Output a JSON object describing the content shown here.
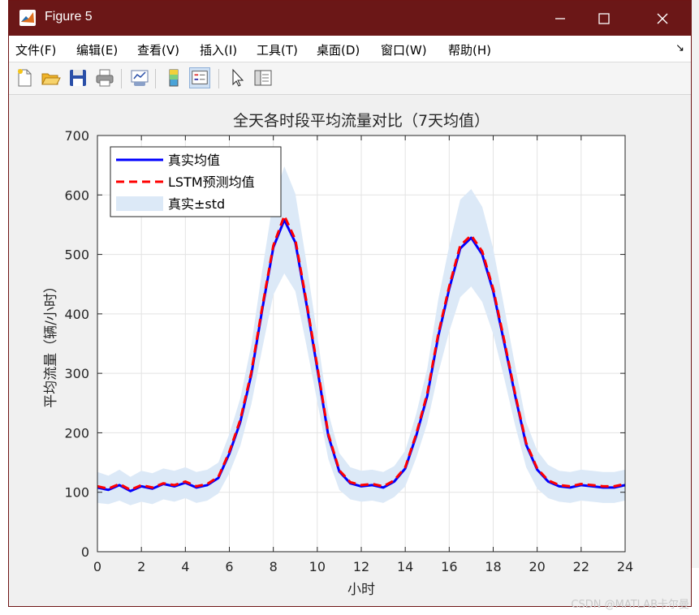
{
  "window": {
    "title": "Figure 5",
    "buttons": [
      "minimize",
      "maximize",
      "close"
    ]
  },
  "menu": {
    "items": [
      {
        "label": "文件",
        "key": "(F)"
      },
      {
        "label": "编辑",
        "key": "(E)"
      },
      {
        "label": "查看",
        "key": "(V)"
      },
      {
        "label": "插入",
        "key": "(I)"
      },
      {
        "label": "工具",
        "key": "(T)"
      },
      {
        "label": "桌面",
        "key": "(D)"
      },
      {
        "label": "窗口",
        "key": "(W)"
      },
      {
        "label": "帮助",
        "key": "(H)"
      }
    ]
  },
  "toolbar": {
    "icons": [
      "new-figure-icon",
      "open-file-icon",
      "save-icon",
      "print-icon",
      "link-plot-icon",
      "insert-colorbar-icon",
      "insert-legend-icon",
      "select-arrow-icon",
      "property-editor-icon"
    ]
  },
  "watermark": "CSDN @MATLAB卡尔曼",
  "colors": {
    "real": "#0000ff",
    "pred": "#ff0000",
    "band": "#dce9f7",
    "titlebar": "#6b1717"
  },
  "chart_data": {
    "type": "line",
    "title": "全天各时段平均流量对比（7天均值）",
    "xlabel": "小时",
    "ylabel": "平均流量（辆/小时）",
    "xlim": [
      0,
      24
    ],
    "ylim": [
      0,
      700
    ],
    "xticks": [
      "0",
      "2",
      "4",
      "6",
      "8",
      "10",
      "12",
      "14",
      "16",
      "18",
      "20",
      "22",
      "24"
    ],
    "yticks": [
      "0",
      "100",
      "200",
      "300",
      "400",
      "500",
      "600",
      "700"
    ],
    "grid": true,
    "legend_position": "top-left",
    "legend": [
      "真实均值",
      "LSTM预测均值",
      "真实±std"
    ],
    "x": [
      0,
      0.5,
      1,
      1.5,
      2,
      2.5,
      3,
      3.5,
      4,
      4.5,
      5,
      5.5,
      6,
      6.5,
      7,
      7.5,
      8,
      8.5,
      9,
      9.5,
      10,
      10.5,
      11,
      11.5,
      12,
      12.5,
      13,
      13.5,
      14,
      14.5,
      15,
      15.5,
      16,
      16.5,
      17,
      17.5,
      18,
      18.5,
      19,
      19.5,
      20,
      20.5,
      21,
      21.5,
      22,
      22.5,
      23,
      23.5,
      24
    ],
    "series": [
      {
        "name": "真实均值",
        "values": [
          108,
          104,
          112,
          102,
          110,
          106,
          114,
          110,
          116,
          108,
          112,
          124,
          165,
          218,
          298,
          408,
          512,
          558,
          520,
          418,
          308,
          195,
          135,
          115,
          110,
          112,
          108,
          118,
          140,
          195,
          262,
          362,
          442,
          510,
          528,
          500,
          438,
          352,
          262,
          180,
          138,
          118,
          110,
          108,
          112,
          110,
          108,
          108,
          112
        ]
      },
      {
        "name": "LSTM预测均值",
        "values": [
          110,
          106,
          114,
          104,
          112,
          108,
          115,
          112,
          118,
          110,
          114,
          126,
          168,
          222,
          302,
          412,
          515,
          565,
          525,
          422,
          312,
          198,
          137,
          117,
          112,
          114,
          110,
          120,
          142,
          198,
          266,
          366,
          446,
          515,
          532,
          505,
          442,
          356,
          265,
          183,
          140,
          120,
          112,
          110,
          114,
          112,
          110,
          110,
          114
        ]
      },
      {
        "name": "真实±std",
        "lower": [
          82,
          80,
          86,
          78,
          84,
          80,
          88,
          84,
          90,
          82,
          86,
          98,
          132,
          178,
          248,
          342,
          432,
          468,
          438,
          348,
          252,
          156,
          104,
          88,
          84,
          86,
          82,
          92,
          110,
          158,
          216,
          300,
          370,
          428,
          446,
          420,
          366,
          292,
          212,
          142,
          106,
          90,
          84,
          82,
          86,
          84,
          82,
          82,
          86
        ],
        "upper": [
          134,
          128,
          138,
          126,
          136,
          132,
          140,
          136,
          142,
          134,
          138,
          150,
          198,
          258,
          348,
          474,
          592,
          648,
          602,
          488,
          364,
          234,
          166,
          142,
          136,
          138,
          134,
          144,
          170,
          232,
          308,
          424,
          514,
          592,
          610,
          580,
          510,
          412,
          312,
          218,
          170,
          146,
          136,
          134,
          138,
          136,
          134,
          134,
          138
        ]
      }
    ]
  }
}
